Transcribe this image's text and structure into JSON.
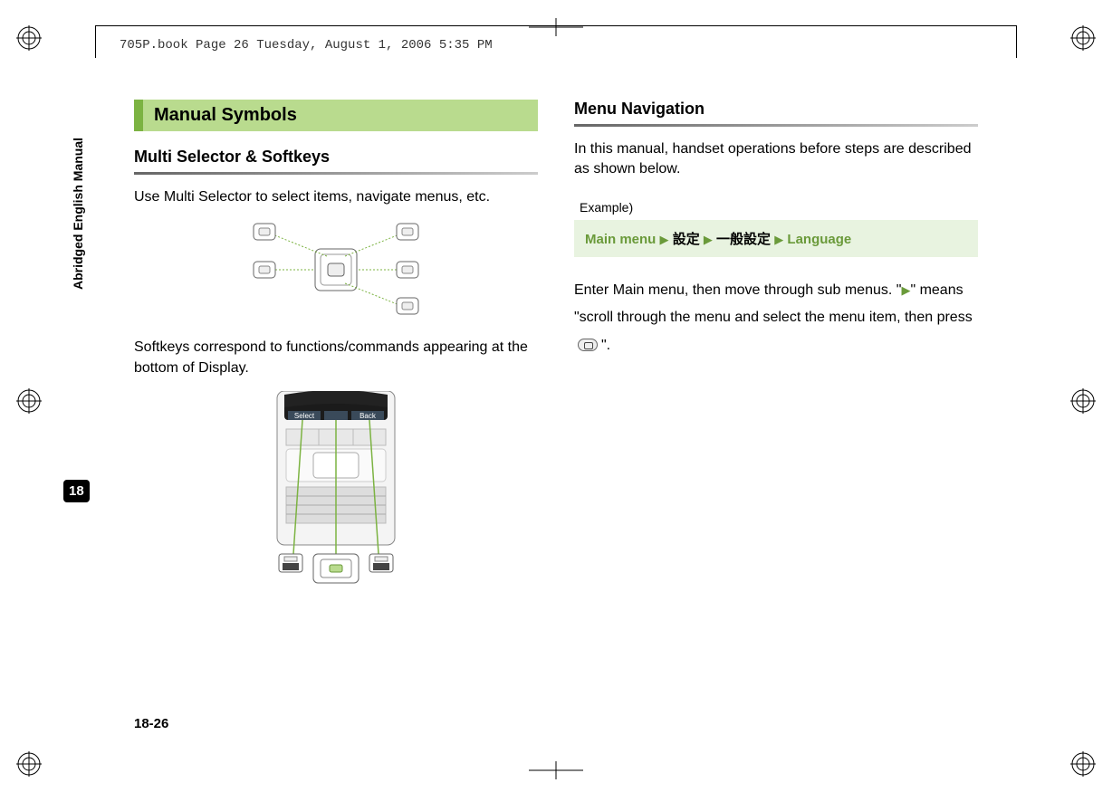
{
  "header": {
    "file_info": "705P.book  Page 26  Tuesday, August 1, 2006  5:35 PM"
  },
  "sidebar": {
    "text": "Abridged English Manual",
    "chapter": "18"
  },
  "page_number": "18-26",
  "left": {
    "section_title": "Manual Symbols",
    "sub1_title": "Multi Selector & Softkeys",
    "sub1_text1": "Use Multi Selector to select items, navigate menus, etc.",
    "sub1_text2": "Softkeys correspond to functions/commands appearing at the bottom of Display.",
    "softkey_left": "Select",
    "softkey_right": "Back"
  },
  "right": {
    "sub_title": "Menu Navigation",
    "intro": "In this manual, handset operations before steps are described as shown below.",
    "example_label": "Example)",
    "nav_main": "Main menu",
    "nav_step1": "設定",
    "nav_step2": "一般設定",
    "nav_step3": "Language",
    "explain_1": "Enter Main menu, then move through sub menus. \"",
    "explain_2": "\" means \"scroll through the menu and select the menu item, then press",
    "explain_3": "\"."
  }
}
